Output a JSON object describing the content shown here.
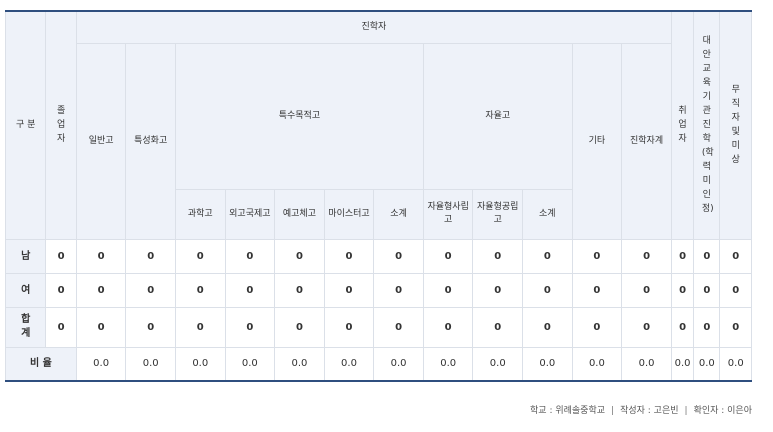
{
  "header": {
    "category": "구 분",
    "graduates": "졸업자",
    "advancement": "진학자",
    "general_high": "일반고",
    "specialized_high": "특성화고",
    "special_purpose_high": "특수목적고",
    "autonomous_high": "자율고",
    "other": "기타",
    "advancement_total": "진학자계",
    "employed": "취업자",
    "alt_edu": "대안교육기관진학(학력미인정)",
    "unemployed": "무직자및미상",
    "science_high": "과학고",
    "foreign_lang_high": "외고국제고",
    "arts_sports_high": "예고체고",
    "meister_high": "마이스터고",
    "subtotal1": "소계",
    "autonomous_private": "자율형사립고",
    "autonomous_public": "자율형공립고",
    "subtotal2": "소계"
  },
  "rows": [
    {
      "label": "남",
      "values": [
        "0",
        "0",
        "0",
        "0",
        "0",
        "0",
        "0",
        "0",
        "0",
        "0",
        "0",
        "0",
        "0",
        "0",
        "0",
        "0"
      ]
    },
    {
      "label": "여",
      "values": [
        "0",
        "0",
        "0",
        "0",
        "0",
        "0",
        "0",
        "0",
        "0",
        "0",
        "0",
        "0",
        "0",
        "0",
        "0",
        "0"
      ]
    },
    {
      "label": "합계",
      "values": [
        "0",
        "0",
        "0",
        "0",
        "0",
        "0",
        "0",
        "0",
        "0",
        "0",
        "0",
        "0",
        "0",
        "0",
        "0",
        "0"
      ]
    }
  ],
  "ratio": {
    "label": "비 율",
    "values": [
      "0.0",
      "0.0",
      "0.0",
      "0.0",
      "0.0",
      "0.0",
      "0.0",
      "0.0",
      "0.0",
      "0.0",
      "0.0",
      "0.0",
      "0.0",
      "0.0",
      "0.0"
    ]
  },
  "footer": {
    "school": "학교 : 위례솔중학교",
    "author": "작성자 : 고은빈",
    "checker": "확인자 : 이은아",
    "separator": "|"
  }
}
